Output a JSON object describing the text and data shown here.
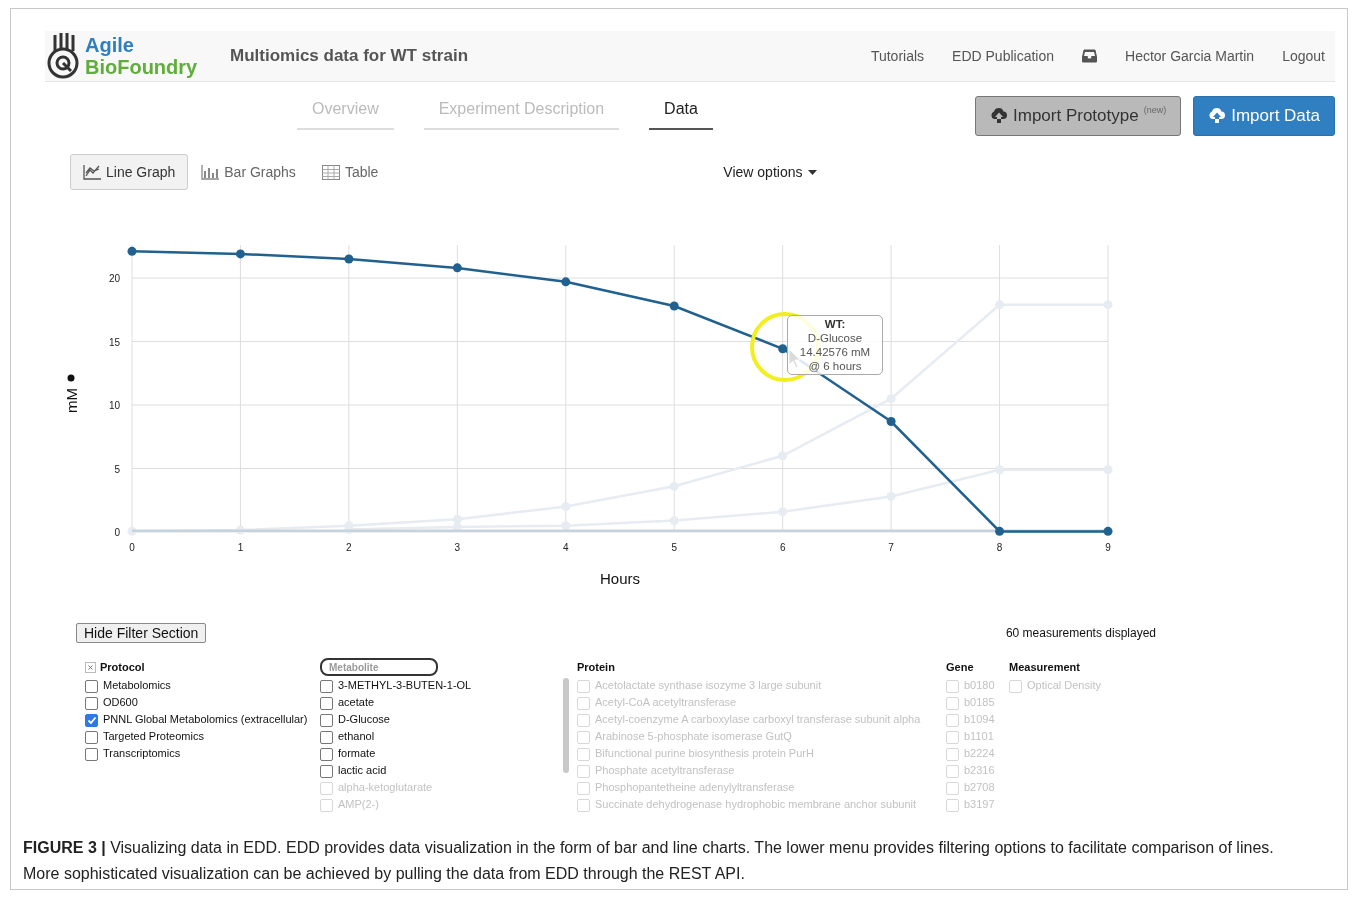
{
  "logo": {
    "line1": "Agile",
    "line2": "BioFoundry"
  },
  "title": "Multiomics data for WT strain",
  "nav": [
    {
      "kind": "link",
      "label": "Tutorials"
    },
    {
      "kind": "link",
      "label": "EDD Publication"
    },
    {
      "kind": "inbox"
    },
    {
      "kind": "link",
      "label": "Hector Garcia Martin"
    },
    {
      "kind": "link",
      "label": "Logout"
    }
  ],
  "tabs": [
    {
      "label": "Overview",
      "selected": false
    },
    {
      "label": "Experiment Description",
      "selected": false
    },
    {
      "label": "Data",
      "selected": true
    }
  ],
  "buttons": [
    {
      "kind": "default",
      "label": "Import Prototype",
      "badge": "(new)"
    },
    {
      "kind": "primary",
      "label": "Import Data"
    }
  ],
  "view_modes": [
    {
      "kind": "line",
      "label": "Line Graph",
      "selected": true
    },
    {
      "kind": "bar",
      "label": "Bar Graphs",
      "selected": false
    },
    {
      "kind": "table",
      "label": "Table",
      "selected": false
    }
  ],
  "view_options": "View options",
  "chart": {
    "chart_data": {
      "type": "line",
      "xlabel": "Hours",
      "ylabel": "mM",
      "x": [
        0,
        1,
        2,
        3,
        4,
        5,
        6,
        7,
        8,
        9
      ],
      "xlim": [
        0,
        9
      ],
      "ylim": [
        0,
        22.6
      ],
      "xticks": [
        0,
        1,
        2,
        3,
        4,
        5,
        6,
        7,
        8,
        9
      ],
      "yticks": [
        0,
        5,
        10,
        15,
        20
      ],
      "grid": true,
      "series": [
        {
          "color": "#e6ecf1",
          "marker": "circle",
          "values": [
            0.05,
            0.15,
            0.5,
            1.0,
            2.0,
            3.6,
            6.0,
            10.5,
            17.9,
            17.9
          ]
        },
        {
          "color": "#e6ecf1",
          "marker": "circle",
          "values": [
            null,
            null,
            0.2,
            0.4,
            0.5,
            0.9,
            1.6,
            2.8,
            4.9,
            4.9
          ]
        },
        {
          "color": "#c5d3de",
          "values": [
            0.1,
            0.1,
            0.1,
            0.1,
            0.1,
            0.1,
            0.1,
            0.1,
            0.1,
            0.1
          ]
        },
        {
          "color": "#21618f",
          "marker": "circle",
          "values": [
            22.1,
            21.9,
            21.5,
            20.8,
            19.7,
            17.8,
            14.43,
            8.7,
            0.05,
            0.05
          ]
        }
      ]
    },
    "tooltip": [
      "WT:",
      "D-Glucose",
      "14.42576 mM",
      "@ 6 hours"
    ]
  },
  "filter": {
    "toggle": "Hide Filter Section",
    "count": "60 measurements displayed",
    "columns": [
      {
        "kind": "protocol",
        "title": "Protocol",
        "items": [
          {
            "label": "Metabolomics",
            "checked": false,
            "disabled": false
          },
          {
            "label": "OD600",
            "checked": false,
            "disabled": false
          },
          {
            "label": "PNNL Global Metabolomics (extracellular)",
            "checked": true,
            "disabled": false
          },
          {
            "label": "Targeted Proteomics",
            "checked": false,
            "disabled": false
          },
          {
            "label": "Transcriptomics",
            "checked": false,
            "disabled": false
          }
        ]
      },
      {
        "kind": "search",
        "placeholder": "Metabolite",
        "items": [
          {
            "label": "3-METHYL-3-BUTEN-1-OL",
            "checked": false,
            "disabled": false
          },
          {
            "label": "acetate",
            "checked": false,
            "disabled": false
          },
          {
            "label": "D-Glucose",
            "checked": false,
            "disabled": false
          },
          {
            "label": "ethanol",
            "checked": false,
            "disabled": false
          },
          {
            "label": "formate",
            "checked": false,
            "disabled": false
          },
          {
            "label": "lactic acid",
            "checked": false,
            "disabled": false
          },
          {
            "label": "alpha-ketoglutarate",
            "checked": false,
            "disabled": true
          },
          {
            "label": "AMP(2-)",
            "checked": false,
            "disabled": true
          }
        ]
      },
      {
        "kind": "scroll",
        "title": "Protein",
        "items": [
          {
            "label": "Acetolactate synthase isozyme 3 large subunit",
            "checked": false,
            "disabled": true
          },
          {
            "label": "Acetyl-CoA acetyltransferase",
            "checked": false,
            "disabled": true
          },
          {
            "label": "Acetyl-coenzyme A carboxylase carboxyl transferase subunit alpha",
            "checked": false,
            "disabled": true
          },
          {
            "label": "Arabinose 5-phosphate isomerase GutQ",
            "checked": false,
            "disabled": true
          },
          {
            "label": "Bifunctional purine biosynthesis protein PurH",
            "checked": false,
            "disabled": true
          },
          {
            "label": "Phosphate acetyltransferase",
            "checked": false,
            "disabled": true
          },
          {
            "label": "Phosphopantetheine adenylyltransferase",
            "checked": false,
            "disabled": true
          },
          {
            "label": "Succinate dehydrogenase hydrophobic membrane anchor subunit",
            "checked": false,
            "disabled": true
          }
        ]
      },
      {
        "kind": "plain",
        "title": "Gene",
        "items": [
          {
            "label": "b0180",
            "checked": false,
            "disabled": true
          },
          {
            "label": "b0185",
            "checked": false,
            "disabled": true
          },
          {
            "label": "b1094",
            "checked": false,
            "disabled": true
          },
          {
            "label": "b1101",
            "checked": false,
            "disabled": true
          },
          {
            "label": "b2224",
            "checked": false,
            "disabled": true
          },
          {
            "label": "b2316",
            "checked": false,
            "disabled": true
          },
          {
            "label": "b2708",
            "checked": false,
            "disabled": true
          },
          {
            "label": "b3197",
            "checked": false,
            "disabled": true
          }
        ]
      },
      {
        "kind": "plain",
        "title": "Measurement",
        "items": [
          {
            "label": "Optical Density",
            "checked": false,
            "disabled": true
          }
        ]
      }
    ]
  },
  "caption": "**FIGURE 3 |** Visualizing data in EDD. EDD provides data visualization in the form of bar and line charts. The lower menu provides filtering options to facilitate comparison of lines. More sophisticated visualization can be achieved by pulling the data from EDD through the REST API."
}
